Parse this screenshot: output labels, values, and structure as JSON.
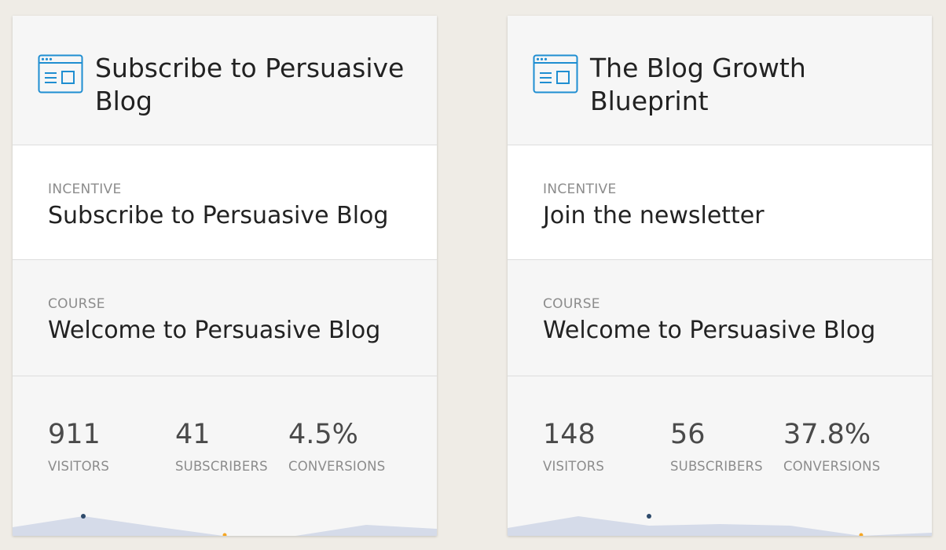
{
  "cards": [
    {
      "title": "Subscribe to Persuasive Blog",
      "icon": "browser-window-icon",
      "incentive_label": "INCENTIVE",
      "incentive": "Subscribe to Persuasive Blog",
      "course_label": "COURSE",
      "course": "Welcome to Persuasive Blog",
      "stats": [
        {
          "value": "911",
          "label": "VISITORS"
        },
        {
          "value": "41",
          "label": "SUBSCRIBERS"
        },
        {
          "value": "4.5%",
          "label": "CONVERSIONS"
        }
      ]
    },
    {
      "title": "The Blog Growth Blueprint",
      "icon": "browser-window-icon",
      "incentive_label": "INCENTIVE",
      "incentive": "Join the newsletter",
      "course_label": "COURSE",
      "course": "Welcome to Persuasive Blog",
      "stats": [
        {
          "value": "148",
          "label": "VISITORS"
        },
        {
          "value": "56",
          "label": "SUBSCRIBERS"
        },
        {
          "value": "37.8%",
          "label": "CONVERSIONS"
        }
      ]
    }
  ],
  "colors": {
    "background": "#efece6",
    "card": "#f6f6f6",
    "icon_blue": "#1f8ed1",
    "spark_fill": "#d5dbe9",
    "spark_point": "#2e4a6b",
    "spark_accent": "#f5a623"
  }
}
